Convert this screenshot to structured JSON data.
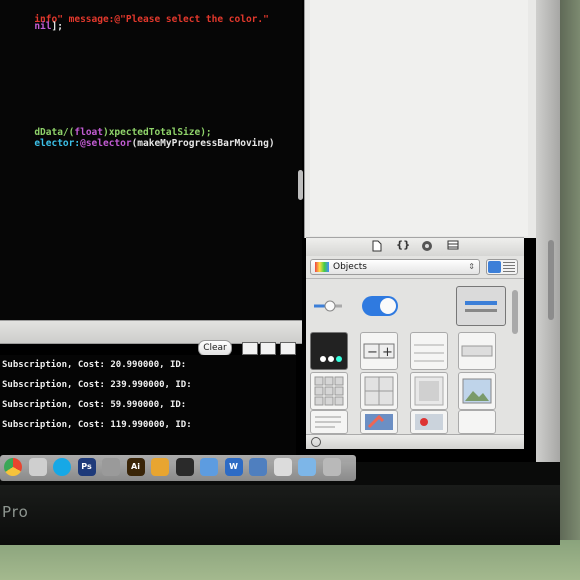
{
  "code": {
    "line1": {
      "a": "info\" message:",
      "b": "@\"Please select the color.\""
    },
    "line2": {
      "a": "nil",
      "b": "];"
    },
    "line3": {
      "a": "dData/(",
      "b": "float",
      "c": ")xpectedTotalSize);"
    },
    "line4": {
      "a": "elector:",
      "b": "@selector",
      "c": "(makeMyProgressBarMoving)"
    }
  },
  "library": {
    "tabs": [
      "file-icon",
      "braces-icon",
      "cube-icon",
      "list-icon"
    ],
    "selector_label": "Objects",
    "selector_arrow": "⇕"
  },
  "debug_bar": {
    "clear_label": "Clear"
  },
  "console_lines": [
    "Subscription, Cost: 20.990000, ID:",
    "Subscription, Cost: 239.990000, ID:",
    "Subscription, Cost: 59.990000, ID:",
    "Subscription, Cost: 119.990000, ID:"
  ],
  "dock": {
    "apps": [
      {
        "name": "chrome-icon",
        "color": "#e8452f"
      },
      {
        "name": "preview-icon",
        "color": "#cfcfcf"
      },
      {
        "name": "skype-icon",
        "color": "#16a8e6"
      },
      {
        "name": "photoshop-icon",
        "label": "Ps",
        "color": "#1e3a7a"
      },
      {
        "name": "system-preferences-icon",
        "color": "#9a9a9a"
      },
      {
        "name": "illustrator-icon",
        "label": "Ai",
        "color": "#3a2508"
      },
      {
        "name": "xcode-icon",
        "color": "#e8a530"
      },
      {
        "name": "activity-monitor-icon",
        "color": "#2a2a2a"
      },
      {
        "name": "folder-icon",
        "color": "#5d9ce0"
      },
      {
        "name": "word-icon",
        "label": "W",
        "color": "#2d6bc5"
      },
      {
        "name": "file-icon",
        "color": "#4f7fbf"
      },
      {
        "name": "document-icon",
        "color": "#dcdcdc"
      },
      {
        "name": "downloads-folder-icon",
        "color": "#7db6e8"
      },
      {
        "name": "trash-icon",
        "color": "#b9b9b9"
      }
    ]
  },
  "bezel": {
    "model_label": "Pro"
  },
  "colors": {
    "string": "#e2382c",
    "keyword": "#c25cd3",
    "accent": "#3c7fd8"
  }
}
